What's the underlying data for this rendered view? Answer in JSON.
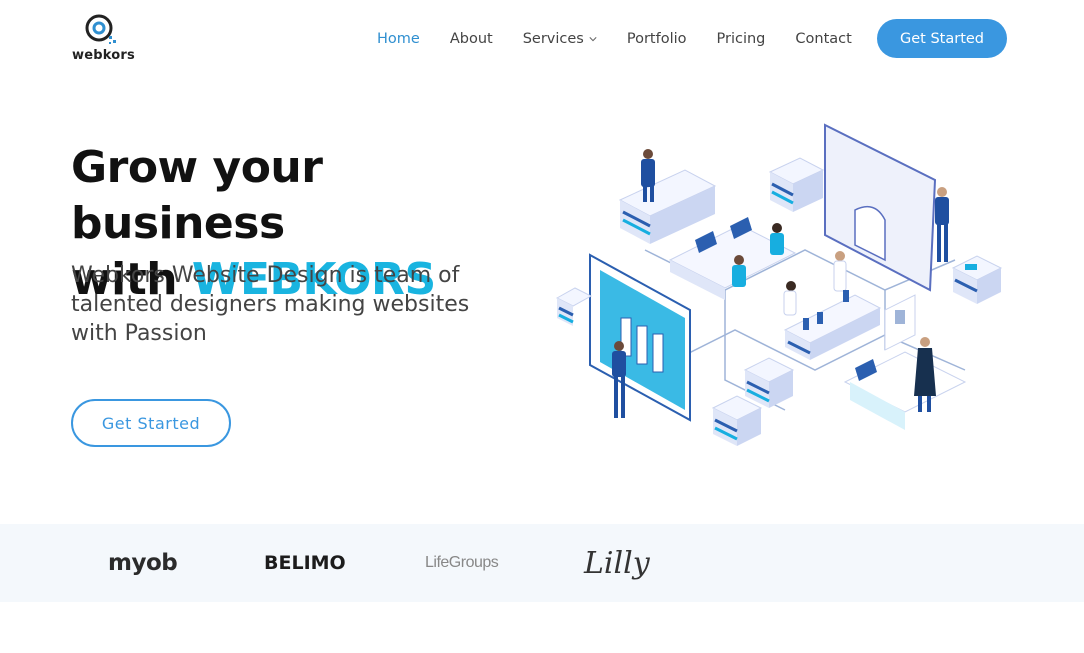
{
  "brand": {
    "name": "webkors",
    "accent": "#3a97e0",
    "highlight": "#19b4e0"
  },
  "nav": {
    "items": [
      {
        "label": "Home",
        "active": true
      },
      {
        "label": "About"
      },
      {
        "label": "Services",
        "has_dropdown": true
      },
      {
        "label": "Portfolio"
      },
      {
        "label": "Pricing"
      },
      {
        "label": "Contact"
      }
    ],
    "cta_label": "Get Started"
  },
  "hero": {
    "title_line1": "Grow your business",
    "title_prefix": "with ",
    "title_brand": "WEBKORS",
    "subtitle": "Webkors Website Design is team of talented designers making websites with Passion",
    "cta_label": "Get Started",
    "illustration": "isometric-office-team-illustration"
  },
  "clients": {
    "logos": [
      {
        "label": "myob"
      },
      {
        "label": "BELIMO"
      },
      {
        "label": "LifeGroups"
      },
      {
        "label": "Lilly"
      }
    ]
  }
}
